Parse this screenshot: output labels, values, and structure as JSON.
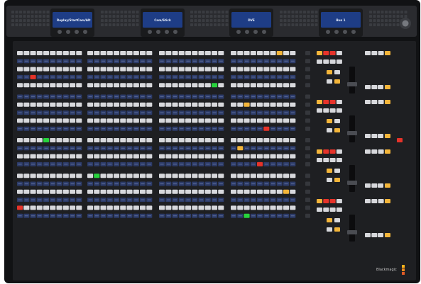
{
  "device": {
    "brand_label": "Blackmagic",
    "brand_colors": [
      "#ffb21c",
      "#f08c1e",
      "#e25a26"
    ]
  },
  "header": {
    "displays": [
      {
        "lines": [
          "Replay/Start",
          "Cam/Alt"
        ],
        "accent_line": 1
      },
      {
        "lines": [
          "Cam/Stick"
        ],
        "accent_line": -1
      },
      {
        "lines": [
          "DVE"
        ],
        "accent_line": -1
      },
      {
        "lines": [
          "Bus 1"
        ],
        "accent_line": -1
      }
    ],
    "joystick_icon": "joystick-icon"
  },
  "colors": {
    "panel": "#1e1f22",
    "header": "#2a2b2f",
    "key_white": "#d7d8dc",
    "key_blue": "#2c3b69",
    "key_dark": "#35373c",
    "tally_red": "#e6332a",
    "tally_green": "#27d33c",
    "tally_amber": "#f3b53a",
    "lcd_bg": "#1e3d86"
  },
  "lit_buttons": [
    {
      "row": 3,
      "section": 0,
      "col": 2,
      "color": "red"
    },
    {
      "row": 4,
      "section": 2,
      "col": 8,
      "color": "green"
    },
    {
      "row": 6,
      "section": 3,
      "col": 2,
      "color": "amber"
    },
    {
      "row": 9,
      "section": 3,
      "col": 5,
      "color": "red"
    },
    {
      "row": 10,
      "section": 0,
      "col": 4,
      "color": "green"
    },
    {
      "row": 11,
      "section": 3,
      "col": 1,
      "color": "amber"
    },
    {
      "row": 13,
      "section": 3,
      "col": 4,
      "color": "red"
    },
    {
      "row": 14,
      "section": 1,
      "col": 1,
      "color": "green"
    },
    {
      "row": 16,
      "section": 3,
      "col": 8,
      "color": "amber"
    },
    {
      "row": 18,
      "section": 0,
      "col": 0,
      "color": "red"
    },
    {
      "row": 19,
      "section": 3,
      "col": 2,
      "color": "green"
    },
    {
      "row": 0,
      "section": 3,
      "col": 7,
      "color": "amber"
    }
  ]
}
